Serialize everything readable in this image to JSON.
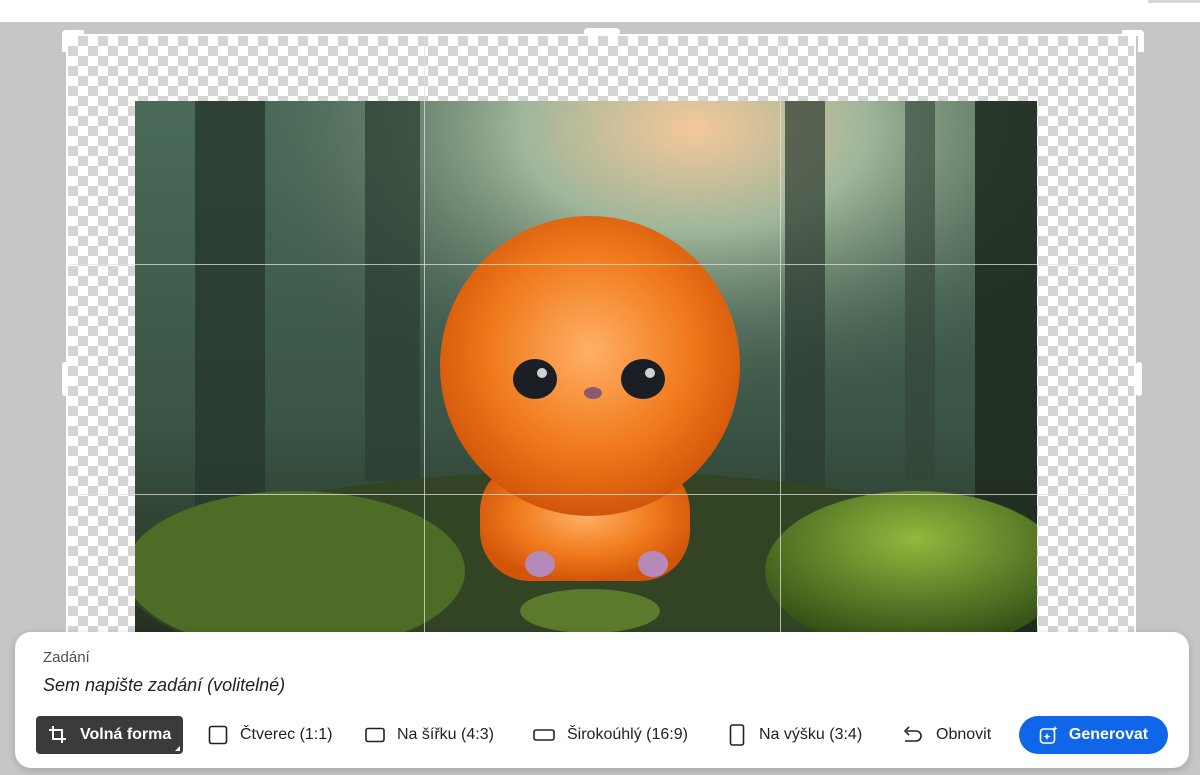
{
  "prompt": {
    "label": "Zadání",
    "placeholder": "Sem napište zadání (volitelné)"
  },
  "aspect_options": [
    {
      "label": "Volná forma",
      "icon": "crop-icon",
      "active": true
    },
    {
      "label": "Čtverec (1:1)",
      "icon": "square-icon",
      "active": false
    },
    {
      "label": "Na šířku (4:3)",
      "icon": "landscape-icon",
      "active": false
    },
    {
      "label": "Širokoúhlý (16:9)",
      "icon": "widescreen-icon",
      "active": false
    },
    {
      "label": "Na výšku (3:4)",
      "icon": "portrait-icon",
      "active": false
    }
  ],
  "reset_label": "Obnovit",
  "generate_label": "Generovat",
  "colors": {
    "generate_button": "#1066e8",
    "active_option": "#3b3b3b",
    "workspace": "#c6c6c6"
  },
  "image_subject": "fluffy orange creature sitting in a misty forest"
}
